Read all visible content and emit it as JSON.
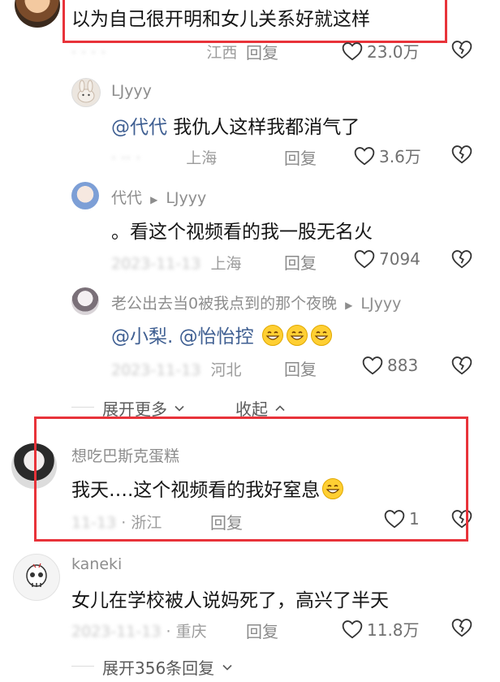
{
  "colors": {
    "highlight_box": "#e8333a",
    "mention": "#3f5f92",
    "meta": "#9c9c9c"
  },
  "comments": [
    {
      "text": "以为自己很开明和女儿关系好就这样",
      "location": "江西",
      "reply_label": "回复",
      "likes": "23.0万"
    },
    {
      "author": "LJyyy",
      "mention": "@代代",
      "text": " 我仇人这样我都消气了",
      "date": "· ·· ·",
      "location": "上海",
      "reply_label": "回复",
      "likes": "3.6万"
    },
    {
      "author": "代代",
      "reply_to": "LJyyy",
      "text": "。看这个视频看的我一股无名火",
      "date": "2023-11-13",
      "location": "上海",
      "reply_label": "回复",
      "likes": "7094"
    },
    {
      "author": "老公出去当0被我点到的那个夜晚",
      "reply_to": "LJyyy",
      "mentions": "@小梨. @怡怡控",
      "date": "2023-11-13",
      "location": "河北",
      "reply_label": "回复",
      "likes": "883"
    },
    {
      "author": "想吃巴斯克蛋糕",
      "text": "我天….这个视频看的我好窒息",
      "date": "11-13",
      "location": "浙江",
      "reply_label": "回复",
      "likes": "1"
    },
    {
      "author": "kaneki",
      "text": "女儿在学校被人说妈死了，高兴了半天",
      "date": "2023-11-13",
      "location": "重庆",
      "reply_label": "回复",
      "likes": "11.8万"
    }
  ],
  "controls": {
    "expand_more": "展开更多",
    "collapse": "收起",
    "expand_replies": "展开356条回复"
  }
}
